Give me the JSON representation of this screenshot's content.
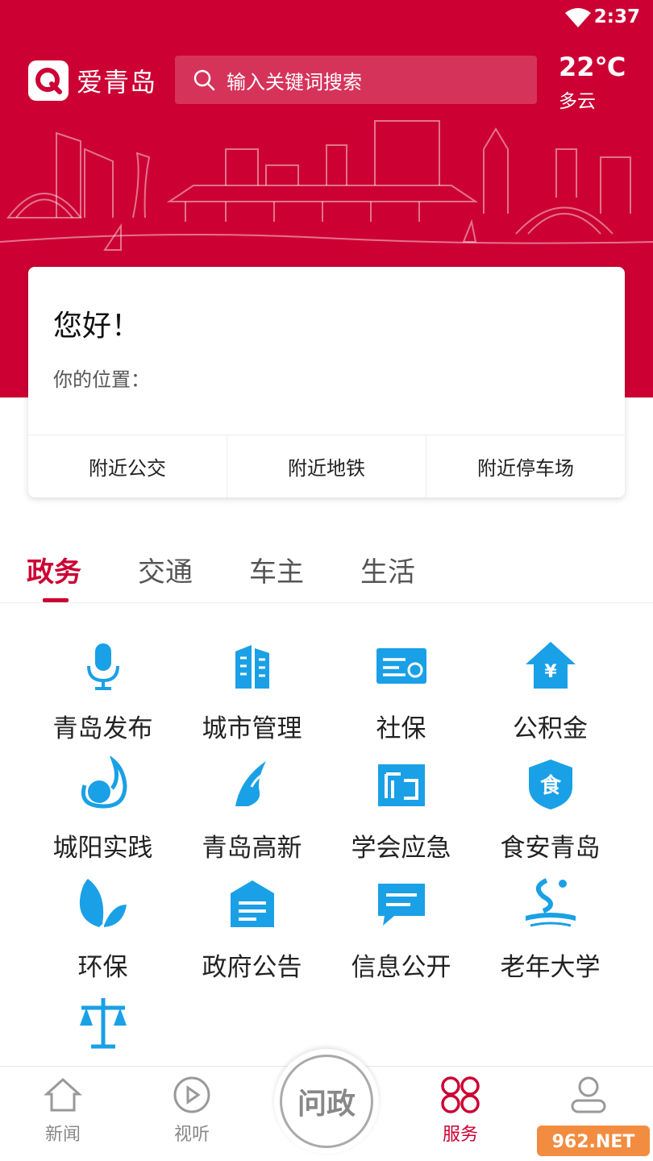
{
  "status_bar": {
    "time": "2:37"
  },
  "header": {
    "app_name": "爱青岛",
    "search_placeholder": "输入关键词搜索",
    "weather": {
      "temp": "22℃",
      "desc": "多云"
    }
  },
  "card": {
    "greeting": "您好！",
    "location_label": "你的位置：",
    "nearby": [
      "附近公交",
      "附近地铁",
      "附近停车场"
    ]
  },
  "tabs": [
    "政务",
    "交通",
    "车主",
    "生活"
  ],
  "active_tab": 0,
  "services": [
    {
      "label": "青岛发布",
      "icon": "microphone-icon"
    },
    {
      "label": "城市管理",
      "icon": "building-icon"
    },
    {
      "label": "社保",
      "icon": "social-security-card-icon"
    },
    {
      "label": "公积金",
      "icon": "housing-fund-icon"
    },
    {
      "label": "城阳实践",
      "icon": "chengyang-icon"
    },
    {
      "label": "青岛高新",
      "icon": "hightech-icon"
    },
    {
      "label": "学会应急",
      "icon": "emergency-icon"
    },
    {
      "label": "食安青岛",
      "icon": "food-safety-icon"
    },
    {
      "label": "环保",
      "icon": "leaf-icon"
    },
    {
      "label": "政府公告",
      "icon": "announcement-icon"
    },
    {
      "label": "信息公开",
      "icon": "message-icon"
    },
    {
      "label": "老年大学",
      "icon": "senior-university-icon"
    },
    {
      "label": "",
      "icon": "scales-icon"
    }
  ],
  "bottom_nav": {
    "items": [
      {
        "label": "新闻",
        "icon": "home-icon"
      },
      {
        "label": "视听",
        "icon": "play-icon"
      },
      {
        "label": "服务",
        "icon": "services-icon"
      },
      {
        "label": "",
        "icon": "profile-icon"
      }
    ],
    "center_label": "问政",
    "active_index": 2
  },
  "colors": {
    "brand": "#cc0033",
    "icon_blue": "#1aa0e6"
  }
}
